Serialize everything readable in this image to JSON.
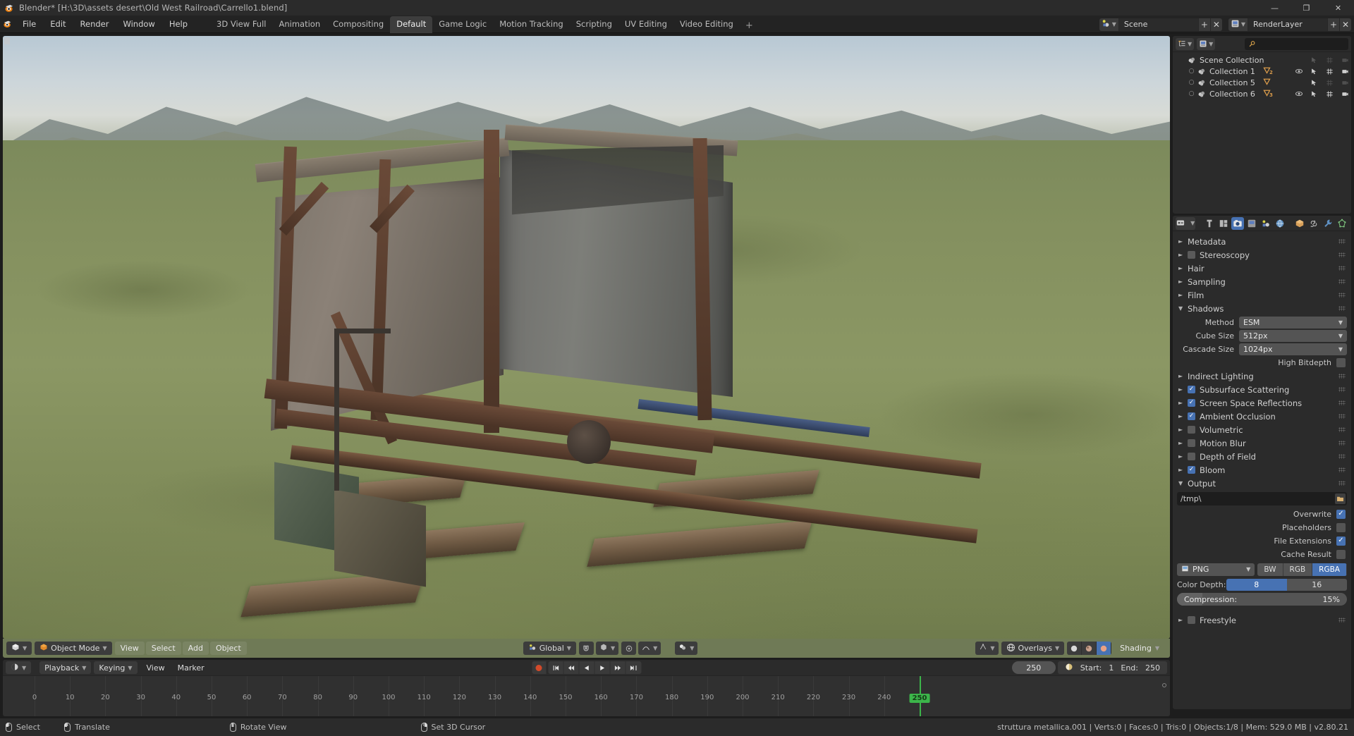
{
  "titlebar": {
    "title": "Blender* [H:\\3D\\assets desert\\Old West Railroad\\Carrello1.blend]",
    "minimize": "—",
    "maximize": "❐",
    "close": "✕"
  },
  "menus": [
    {
      "label": "File"
    },
    {
      "label": "Edit"
    },
    {
      "label": "Render"
    },
    {
      "label": "Window"
    },
    {
      "label": "Help"
    }
  ],
  "workspaces": [
    {
      "label": "3D View Full",
      "active": false
    },
    {
      "label": "Animation",
      "active": false
    },
    {
      "label": "Compositing",
      "active": false
    },
    {
      "label": "Default",
      "active": true
    },
    {
      "label": "Game Logic",
      "active": false
    },
    {
      "label": "Motion Tracking",
      "active": false
    },
    {
      "label": "Scripting",
      "active": false
    },
    {
      "label": "UV Editing",
      "active": false
    },
    {
      "label": "Video Editing",
      "active": false
    },
    {
      "label": "+",
      "active": false
    }
  ],
  "topbar_right": {
    "scene_name": "Scene",
    "scene_add": "+",
    "scene_remove": "✕",
    "viewlayer_name": "RenderLayer",
    "viewlayer_add": "+",
    "viewlayer_remove": "✕"
  },
  "outliner": {
    "display_mode_icon": "view-layer-icon",
    "filter_icon": "filter-icon",
    "search_placeholder": "",
    "search_value": "",
    "rows": [
      {
        "label": "Scene Collection",
        "indent": 0,
        "icon": "collection-icon",
        "expander": "",
        "has_visibility": false,
        "has_selectable": false,
        "has_render": false,
        "has_camera": false,
        "badge": "",
        "badge_count": ""
      },
      {
        "label": "Collection 1",
        "indent": 1,
        "icon": "collection-icon",
        "expander": "○",
        "has_visibility": true,
        "has_selectable": true,
        "has_render": true,
        "has_camera": true,
        "badge": "mesh-cone-icon",
        "badge_count": "2"
      },
      {
        "label": "Collection 5",
        "indent": 1,
        "icon": "collection-icon",
        "expander": "○",
        "has_visibility": false,
        "has_selectable": true,
        "has_render": false,
        "has_camera": false,
        "badge": "mesh-cone-icon",
        "badge_count": ""
      },
      {
        "label": "Collection 6",
        "indent": 1,
        "icon": "collection-icon",
        "expander": "○",
        "has_visibility": true,
        "has_selectable": true,
        "has_render": true,
        "has_camera": true,
        "badge": "mesh-cone-icon",
        "badge_count": "3"
      }
    ]
  },
  "properties": {
    "tabs": [
      {
        "name": "editor-type",
        "icon": "properties-editor-icon",
        "active": false,
        "kind": "editor"
      },
      {
        "name": "tool",
        "icon": "tool-icon",
        "active": false,
        "kind": "normal"
      },
      {
        "name": "render-layers",
        "icon": "view-layer-icon",
        "active": false,
        "kind": "normal"
      },
      {
        "name": "render",
        "icon": "camera-back-icon",
        "active": true,
        "kind": "normal"
      },
      {
        "name": "output",
        "icon": "printer-icon",
        "active": false,
        "kind": "normal"
      },
      {
        "name": "scene",
        "icon": "scene-icon",
        "active": false,
        "kind": "normal"
      },
      {
        "name": "world",
        "icon": "world-icon",
        "active": false,
        "kind": "normal"
      },
      {
        "name": "object",
        "icon": "object-cube-icon",
        "active": false,
        "kind": "normal"
      },
      {
        "name": "constraints",
        "icon": "chain-link-icon",
        "active": false,
        "kind": "normal"
      },
      {
        "name": "modifiers",
        "icon": "wrench-icon",
        "active": false,
        "kind": "normal"
      },
      {
        "name": "data",
        "icon": "mesh-data-icon",
        "active": false,
        "kind": "normal"
      }
    ],
    "panels": [
      {
        "label": "Metadata",
        "open": false,
        "checkbox": null
      },
      {
        "label": "Stereoscopy",
        "open": false,
        "checkbox": false
      },
      {
        "label": "Hair",
        "open": false,
        "checkbox": null
      },
      {
        "label": "Sampling",
        "open": false,
        "checkbox": null
      },
      {
        "label": "Film",
        "open": false,
        "checkbox": null
      }
    ],
    "shadows": {
      "label": "Shadows",
      "open": true,
      "method_label": "Method",
      "method_value": "ESM",
      "cube_size_label": "Cube Size",
      "cube_size_value": "512px",
      "cascade_size_label": "Cascade Size",
      "cascade_size_value": "1024px",
      "high_bitdepth_label": "High Bitdepth",
      "high_bitdepth_checked": false
    },
    "effects": [
      {
        "label": "Indirect Lighting",
        "checkbox": null
      },
      {
        "label": "Subsurface Scattering",
        "checkbox": true
      },
      {
        "label": "Screen Space Reflections",
        "checkbox": true
      },
      {
        "label": "Ambient Occlusion",
        "checkbox": true
      },
      {
        "label": "Volumetric",
        "checkbox": false
      },
      {
        "label": "Motion Blur",
        "checkbox": false
      },
      {
        "label": "Depth of Field",
        "checkbox": false
      },
      {
        "label": "Bloom",
        "checkbox": true
      }
    ],
    "output": {
      "label": "Output",
      "open": true,
      "path_value": "/tmp\\",
      "toggles": [
        {
          "label": "Overwrite",
          "checked": true
        },
        {
          "label": "Placeholders",
          "checked": false
        },
        {
          "label": "File Extensions",
          "checked": true
        },
        {
          "label": "Cache Result",
          "checked": false
        }
      ],
      "file_format": "PNG",
      "color_modes": [
        {
          "label": "BW",
          "on": false
        },
        {
          "label": "RGB",
          "on": false
        },
        {
          "label": "RGBA",
          "on": true
        }
      ],
      "color_depth_label": "Color Depth:",
      "color_depths": [
        {
          "label": "8",
          "on": true
        },
        {
          "label": "16",
          "on": false
        }
      ],
      "compression_label": "Compression:",
      "compression_value": "15%",
      "compression_percent": 15
    },
    "freestyle": {
      "label": "Freestyle",
      "checked": false,
      "open": false
    }
  },
  "viewport_header": {
    "editor_type_icon": "editor-3dview-icon",
    "mode": "Object Mode",
    "menus": [
      {
        "label": "View"
      },
      {
        "label": "Select"
      },
      {
        "label": "Add"
      },
      {
        "label": "Object"
      }
    ],
    "transform_orientation": "Global",
    "snap_icon": "magnet-icon",
    "snap_type_icon": "snap-increment-icon",
    "proportional_icon": "proportional-edit-icon",
    "proportional_falloff_icon": "falloff-smooth-icon",
    "viewport_visibility_icon": "object-types-icon",
    "gizmo_icon": "gizmo-icon",
    "overlays_label": "Overlays",
    "shading_label": "Shading",
    "shading_modes": [
      {
        "icon": "shading-solid-icon",
        "on": false
      },
      {
        "icon": "shading-material-icon",
        "on": false
      },
      {
        "icon": "shading-rendered-icon",
        "on": true
      }
    ]
  },
  "timeline": {
    "editor_icon": "editor-timeline-icon",
    "menus": [
      {
        "label": "Playback",
        "dropdown": true
      },
      {
        "label": "Keying",
        "dropdown": true
      },
      {
        "label": "View",
        "dropdown": false
      },
      {
        "label": "Marker",
        "dropdown": false
      }
    ],
    "transport": [
      {
        "name": "record-button",
        "glyph": "●"
      },
      {
        "name": "jump-to-start-button",
        "glyph": "⏮"
      },
      {
        "name": "jump-to-prev-keyframe-button",
        "glyph": "⏪"
      },
      {
        "name": "play-reverse-button",
        "glyph": "◀"
      },
      {
        "name": "play-button",
        "glyph": "▶"
      },
      {
        "name": "jump-to-next-keyframe-button",
        "glyph": "⏩"
      },
      {
        "name": "jump-to-end-button",
        "glyph": "⏭"
      }
    ],
    "current_frame": "250",
    "start_label": "Start:",
    "start_value": "1",
    "end_label": "End:",
    "end_value": "250",
    "ruler_ticks": [
      "0",
      "10",
      "20",
      "30",
      "40",
      "50",
      "60",
      "70",
      "80",
      "90",
      "100",
      "110",
      "120",
      "130",
      "140",
      "150",
      "160",
      "170",
      "180",
      "190",
      "200",
      "210",
      "220",
      "230",
      "240"
    ],
    "playhead_label": "250",
    "playhead_frame": 250
  },
  "statusbar": {
    "hints": [
      {
        "mouse": "left",
        "label": "Select"
      },
      {
        "mouse": "left-drag",
        "label": "Translate"
      },
      {
        "mouse": "middle",
        "label": "Rotate View"
      },
      {
        "mouse": "right",
        "label": "Set 3D Cursor"
      }
    ],
    "info": "struttura metallica.001 | Verts:0 | Faces:0 | Tris:0 | Objects:1/8 | Mem: 529.0 MB | v2.80.21"
  },
  "colors": {
    "accent_blue": "#4772b3",
    "header_green": "#6f7a56",
    "panel_bg": "#2b2b2b",
    "app_bg": "#1d1d1d",
    "playhead_green": "#3cb54a",
    "record_red": "#d24a2a"
  }
}
